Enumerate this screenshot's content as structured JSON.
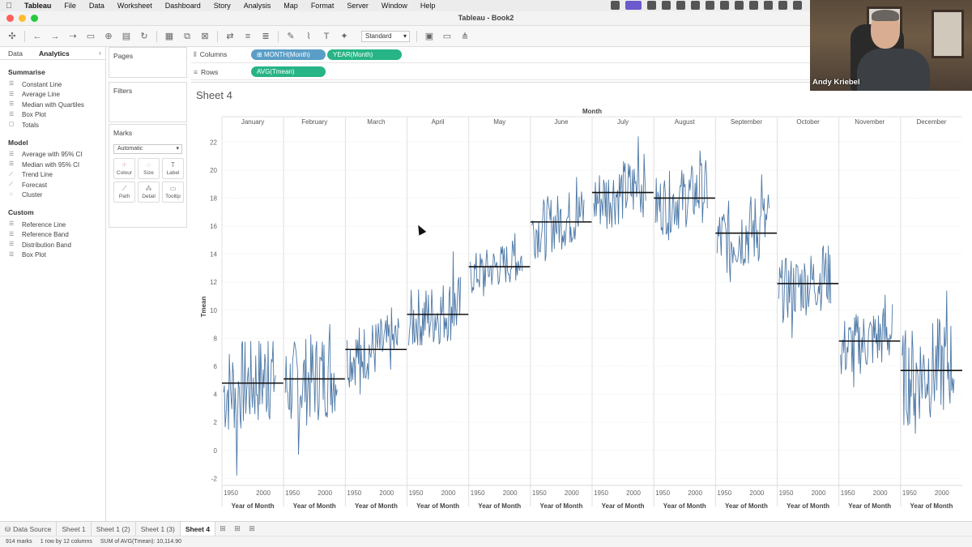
{
  "menubar": {
    "items": [
      "Tableau",
      "File",
      "Data",
      "Worksheet",
      "Dashboard",
      "Story",
      "Analysis",
      "Map",
      "Format",
      "Server",
      "Window",
      "Help"
    ]
  },
  "window": {
    "title": "Tableau - Book2"
  },
  "toolbar": {
    "fit_value": "Standard"
  },
  "left_panel": {
    "tabs": [
      "Data",
      "Analytics"
    ],
    "sections": [
      {
        "title": "Summarise",
        "items": [
          "Constant Line",
          "Average Line",
          "Median with Quartiles",
          "Box Plot",
          "Totals"
        ]
      },
      {
        "title": "Model",
        "items": [
          "Average with 95% CI",
          "Median with 95% CI",
          "Trend Line",
          "Forecast",
          "Cluster"
        ]
      },
      {
        "title": "Custom",
        "items": [
          "Reference Line",
          "Reference Band",
          "Distribution Band",
          "Box Plot"
        ]
      }
    ]
  },
  "cards": {
    "pages": "Pages",
    "filters": "Filters",
    "marks": "Marks",
    "mark_type": "Automatic",
    "mark_buttons": [
      "Colour",
      "Size",
      "Label",
      "Path",
      "Detail",
      "Tooltip"
    ]
  },
  "shelves": {
    "columns_label": "Columns",
    "rows_label": "Rows",
    "columns_pills": [
      "MONTH(Month)",
      "YEAR(Month)"
    ],
    "rows_pills": [
      "AVG(Tmean)"
    ]
  },
  "sheet": {
    "title": "Sheet 4"
  },
  "colors": {
    "line": "#4e79a7",
    "ref_line": "#111111",
    "pill_blue": "#5b9bd5",
    "pill_green": "#27b486",
    "pill_month": "#5a9ec7"
  },
  "chart_data": {
    "type": "line",
    "title": "",
    "top_header": "Month",
    "categories": [
      "January",
      "February",
      "March",
      "April",
      "May",
      "June",
      "July",
      "August",
      "September",
      "October",
      "November",
      "December"
    ],
    "xlabel": "Year of Month",
    "x_ticks": [
      "1950",
      "2000"
    ],
    "ylabel": "Tmean",
    "ylim": [
      -2.5,
      23
    ],
    "y_ticks": [
      -2,
      0,
      2,
      4,
      6,
      8,
      10,
      12,
      14,
      16,
      18,
      20,
      22
    ],
    "averages": [
      4.8,
      5.1,
      7.2,
      9.7,
      13.1,
      16.3,
      18.4,
      18.0,
      15.5,
      11.9,
      7.8,
      5.7
    ],
    "ranges_min": [
      -1.8,
      -0.3,
      4.0,
      7.5,
      11.0,
      13.5,
      15.8,
      15.0,
      12.0,
      8.0,
      4.5,
      1.2
    ],
    "ranges_max": [
      7.8,
      9.0,
      10.2,
      14.2,
      15.5,
      19.5,
      22.4,
      21.4,
      19.7,
      14.6,
      11.1,
      11.4
    ],
    "grid": true
  },
  "sheet_tabs": [
    "Data Source",
    "Sheet 1",
    "Sheet 1 (2)",
    "Sheet 1 (3)",
    "Sheet 4"
  ],
  "status": {
    "marks": "914 marks",
    "dims": "1 row by 12 columns",
    "sum": "SUM of AVG(Tmean): 10,114.90"
  },
  "webcam": {
    "name": "Andy Kriebel"
  }
}
